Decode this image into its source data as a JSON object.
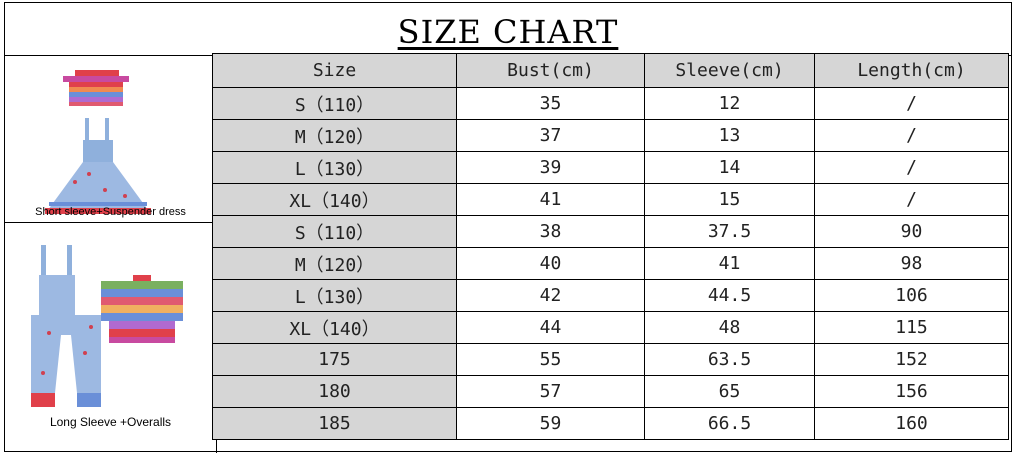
{
  "title": "SIZE CHART",
  "columns": [
    "Size",
    "Bust(cm)",
    "Sleeve(cm)",
    "Length(cm)"
  ],
  "groups": [
    {
      "caption": "Short sleeve+Suspender dress",
      "image": "short-sleeve-and-suspender-dress",
      "rows": [
        [
          "S（110）",
          "35",
          "12",
          "/"
        ],
        [
          "M（120）",
          "37",
          "13",
          "/"
        ],
        [
          "L（130）",
          "39",
          "14",
          "/"
        ],
        [
          "XL（140）",
          "41",
          "15",
          "/"
        ]
      ]
    },
    {
      "caption": "Long Sleeve +Overalls",
      "image": "long-sleeve-and-overalls",
      "rows": [
        [
          "S（110）",
          "38",
          "37.5",
          "90"
        ],
        [
          "M（120）",
          "40",
          "41",
          "98"
        ],
        [
          "L（130）",
          "42",
          "44.5",
          "106"
        ],
        [
          "XL（140）",
          "44",
          "48",
          "115"
        ],
        [
          "175",
          "55",
          "63.5",
          "152"
        ],
        [
          "180",
          "57",
          "65",
          "156"
        ],
        [
          "185",
          "59",
          "66.5",
          "160"
        ]
      ]
    }
  ],
  "colors": {
    "header_fill": "#d6d6d6",
    "denim": "#8fb0dc",
    "stripe_red": "#e0404a",
    "stripe_blue": "#6a8fd8"
  }
}
